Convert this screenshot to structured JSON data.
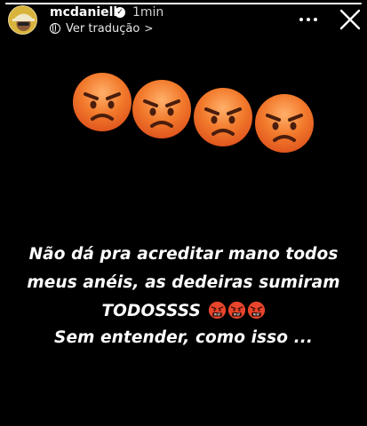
{
  "story": {
    "progress": 1.0,
    "username": "mcdaniell",
    "verified": true,
    "time_ago": "1min",
    "translate_label": "Ver tradução",
    "translate_chevron": ">"
  },
  "icons": {
    "avatar": "profile-photo",
    "verified": "verified-badge-icon",
    "globe": "globe-icon",
    "more": "more-options-icon",
    "close": "close-icon",
    "angry_face": "angry-face-emoji",
    "cursing_face": "face-with-symbols-on-mouth-emoji"
  },
  "colors": {
    "background": "#000000",
    "text": "#ffffff",
    "emoji_orange": "#f07a2e",
    "emoji_red": "#e53a2a"
  },
  "caption": {
    "line1": "Não dá pra acreditar mano todos",
    "line2": "meus anéis, as dedeiras sumiram",
    "line3": "TODOSSSS",
    "line4": "Sem entender, como isso ..."
  }
}
